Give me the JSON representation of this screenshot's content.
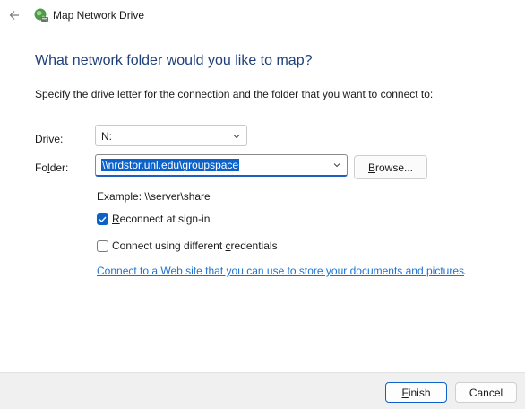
{
  "window": {
    "title": "Map Network Drive",
    "back_icon": "arrow-left-icon",
    "app_icon": "network-drive-icon"
  },
  "content": {
    "heading": "What network folder would you like to map?",
    "instruction": "Specify the drive letter for the connection and the folder that you want to connect to:",
    "drive_label_access": "D",
    "drive_label_rest": "rive:",
    "drive_value": "N:",
    "folder_label_pre": "Fo",
    "folder_label_access": "l",
    "folder_label_rest": "der:",
    "folder_value": "\\\\nrdstor.unl.edu\\groupspace",
    "browse_access": "B",
    "browse_rest": "rowse...",
    "example": "Example: \\\\server\\share",
    "reconnect_access": "R",
    "reconnect_rest": "econnect at sign-in",
    "reconnect_checked": true,
    "creds_pre": "Connect using different ",
    "creds_access": "c",
    "creds_rest": "redentials",
    "creds_checked": false,
    "web_link": "Connect to a Web site that you can use to store your documents and pictures",
    "web_link_period": "."
  },
  "footer": {
    "finish_access": "F",
    "finish_rest": "inish",
    "cancel_label": "Cancel"
  },
  "colors": {
    "heading": "#1f3f7a",
    "accent": "#0c62c9",
    "link": "#1a73d4",
    "footer_bg": "#f0f0f0"
  }
}
